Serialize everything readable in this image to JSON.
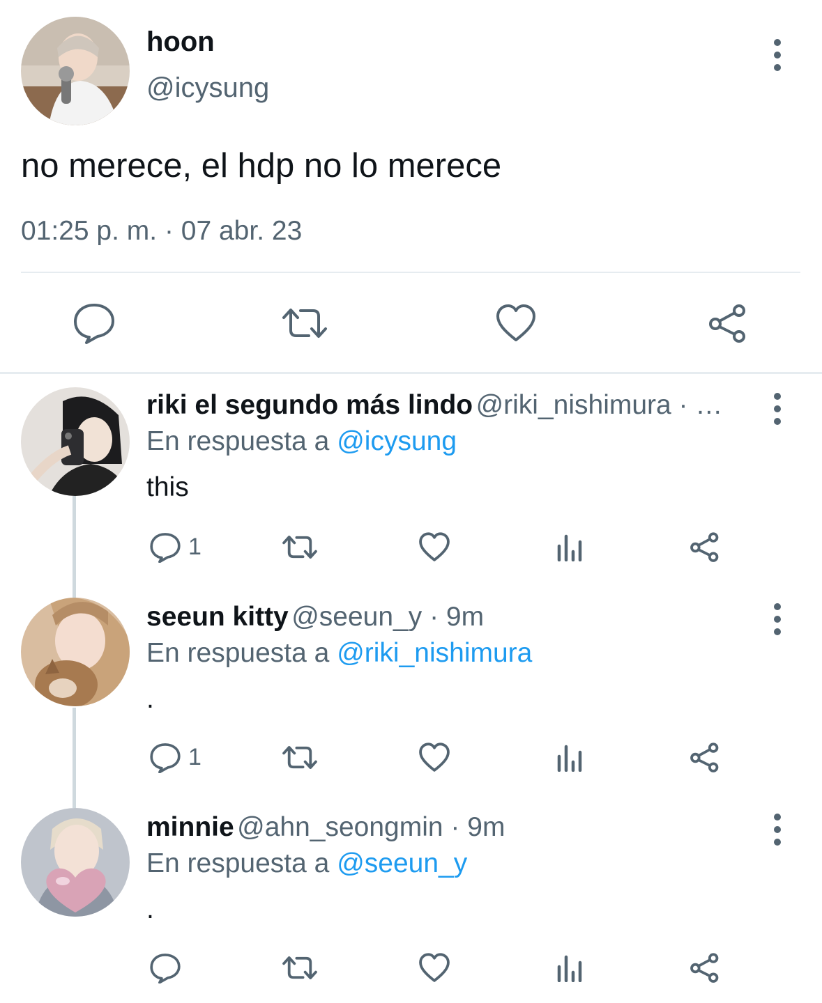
{
  "main_tweet": {
    "name": "hoon",
    "handle": "@icysung",
    "text": "no merece, el hdp no lo merece",
    "timestamp": "01:25 p. m. · 07 abr. 23",
    "actions": [
      "reply-icon",
      "retweet-icon",
      "like-icon",
      "share-icon"
    ]
  },
  "replies": [
    {
      "name": "riki el segundo más lindo",
      "handle_time": "@riki_nishimura · …",
      "reply_prefix": "En respuesta a",
      "reply_mention": "@icysung",
      "text": "this",
      "reply_count": "1"
    },
    {
      "name": "seeun kitty",
      "handle_time": "@seeun_y · 9m",
      "reply_prefix": "En respuesta a",
      "reply_mention": "@riki_nishimura",
      "text": ".",
      "reply_count": "1"
    },
    {
      "name": "minnie",
      "handle_time": "@ahn_seongmin · 9m",
      "reply_prefix": "En respuesta a",
      "reply_mention": "@seeun_y",
      "text": ".",
      "reply_count": ""
    }
  ],
  "colors": {
    "text": "#0f1419",
    "secondary": "#536471",
    "link": "#1d9bf0",
    "divider": "#e6ecf0",
    "thread_line": "#cfd9de"
  }
}
